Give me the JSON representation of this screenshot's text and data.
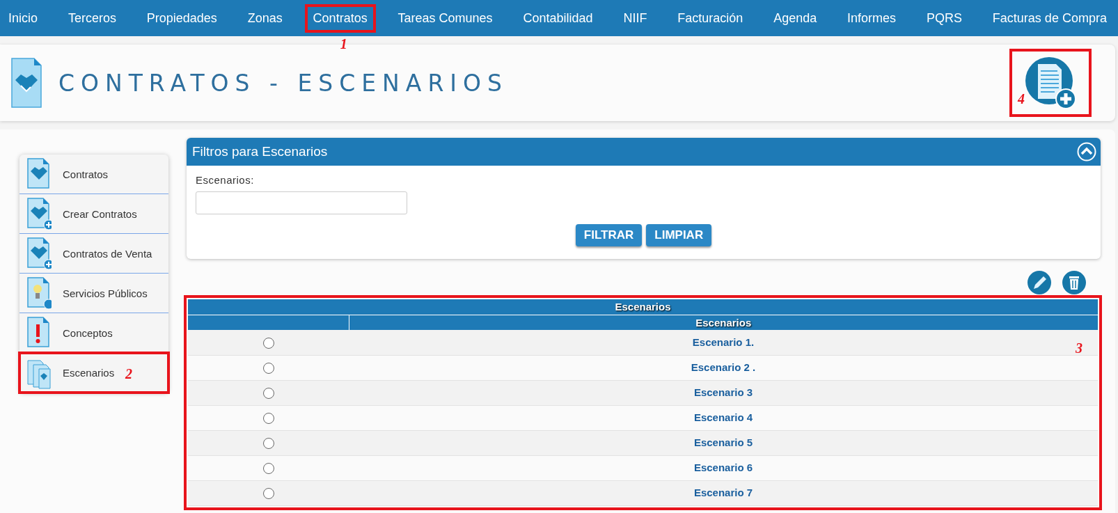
{
  "nav": [
    {
      "label": "Inicio"
    },
    {
      "label": "Terceros"
    },
    {
      "label": "Propiedades"
    },
    {
      "label": "Zonas"
    },
    {
      "label": "Contratos",
      "annotation": "1"
    },
    {
      "label": "Tareas Comunes"
    },
    {
      "label": "Contabilidad"
    },
    {
      "label": "NIIF"
    },
    {
      "label": "Facturación"
    },
    {
      "label": "Agenda"
    },
    {
      "label": "Informes"
    },
    {
      "label": "PQRS"
    },
    {
      "label": "Facturas de Compra"
    }
  ],
  "header": {
    "title": "CONTRATOS - ESCENARIOS",
    "add_annotation": "4"
  },
  "sidebar": {
    "items": [
      {
        "label": "Contratos"
      },
      {
        "label": "Crear Contratos"
      },
      {
        "label": "Contratos de Venta"
      },
      {
        "label": "Servicios Públicos"
      },
      {
        "label": "Conceptos"
      },
      {
        "label": "Escenarios",
        "annotation": "2"
      }
    ]
  },
  "filter": {
    "title": "Filtros para Escenarios",
    "field_label": "Escenarios:",
    "buttons": [
      "FILTRAR",
      "LIMPIAR"
    ]
  },
  "table": {
    "caption": "Escenarios",
    "columns": [
      "Escenarios"
    ],
    "annotation": "3",
    "rows": [
      {
        "name": "Escenario 1.",
        "selected": false
      },
      {
        "name": "Escenario 2 .",
        "selected": false
      },
      {
        "name": "Escenario 3",
        "selected": false
      },
      {
        "name": "Escenario 4",
        "selected": false
      },
      {
        "name": "Escenario 5",
        "selected": false
      },
      {
        "name": "Escenario 6",
        "selected": false
      },
      {
        "name": "Escenario 7",
        "selected": false
      }
    ]
  }
}
